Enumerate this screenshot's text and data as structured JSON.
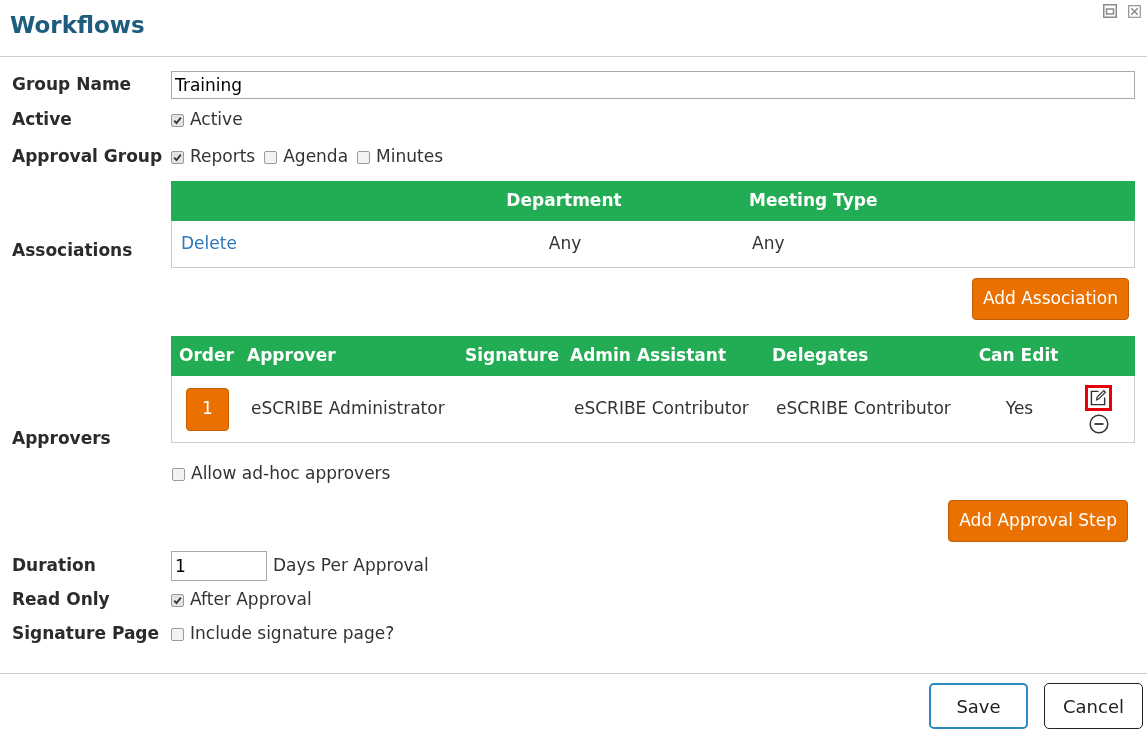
{
  "window": {
    "title": "Workflows"
  },
  "form": {
    "group_name": {
      "label": "Group Name",
      "value": "Training"
    },
    "active": {
      "label": "Active",
      "options": [
        {
          "label": "Active",
          "checked": true
        }
      ]
    },
    "approval_group": {
      "label": "Approval Group",
      "options": [
        {
          "label": "Reports",
          "checked": true
        },
        {
          "label": "Agenda",
          "checked": false
        },
        {
          "label": "Minutes",
          "checked": false
        }
      ]
    },
    "associations": {
      "label": "Associations",
      "table": {
        "columns": [
          "Department",
          "Meeting Type"
        ],
        "rows": [
          {
            "action": "Delete",
            "department": "Any",
            "meeting_type": "Any"
          }
        ]
      },
      "add_button": "Add Association"
    },
    "approvers": {
      "label": "Approvers",
      "table": {
        "columns": [
          "Order",
          "Approver",
          "Signature",
          "Admin Assistant",
          "Delegates",
          "Can Edit"
        ],
        "rows": [
          {
            "order": "1",
            "approver": "eSCRIBE Administrator",
            "admin_assistant": "eSCRIBE Contributor",
            "delegates": "eSCRIBE Contributor",
            "can_edit": "Yes",
            "edit_highlighted": true
          }
        ]
      },
      "ad_hoc": {
        "label": "Allow ad-hoc approvers",
        "checked": false
      },
      "add_button": "Add Approval Step"
    },
    "duration": {
      "label": "Duration",
      "value": "1",
      "unit": "Days Per Approval"
    },
    "read_only": {
      "label": "Read Only",
      "options": [
        {
          "label": "After Approval",
          "checked": true
        }
      ]
    },
    "signature_page": {
      "label": "Signature Page",
      "options": [
        {
          "label": "Include signature page?",
          "checked": false
        }
      ]
    }
  },
  "footer": {
    "buttons": [
      {
        "label": "Save",
        "focused": true
      },
      {
        "label": "Cancel",
        "focused": false
      }
    ]
  }
}
